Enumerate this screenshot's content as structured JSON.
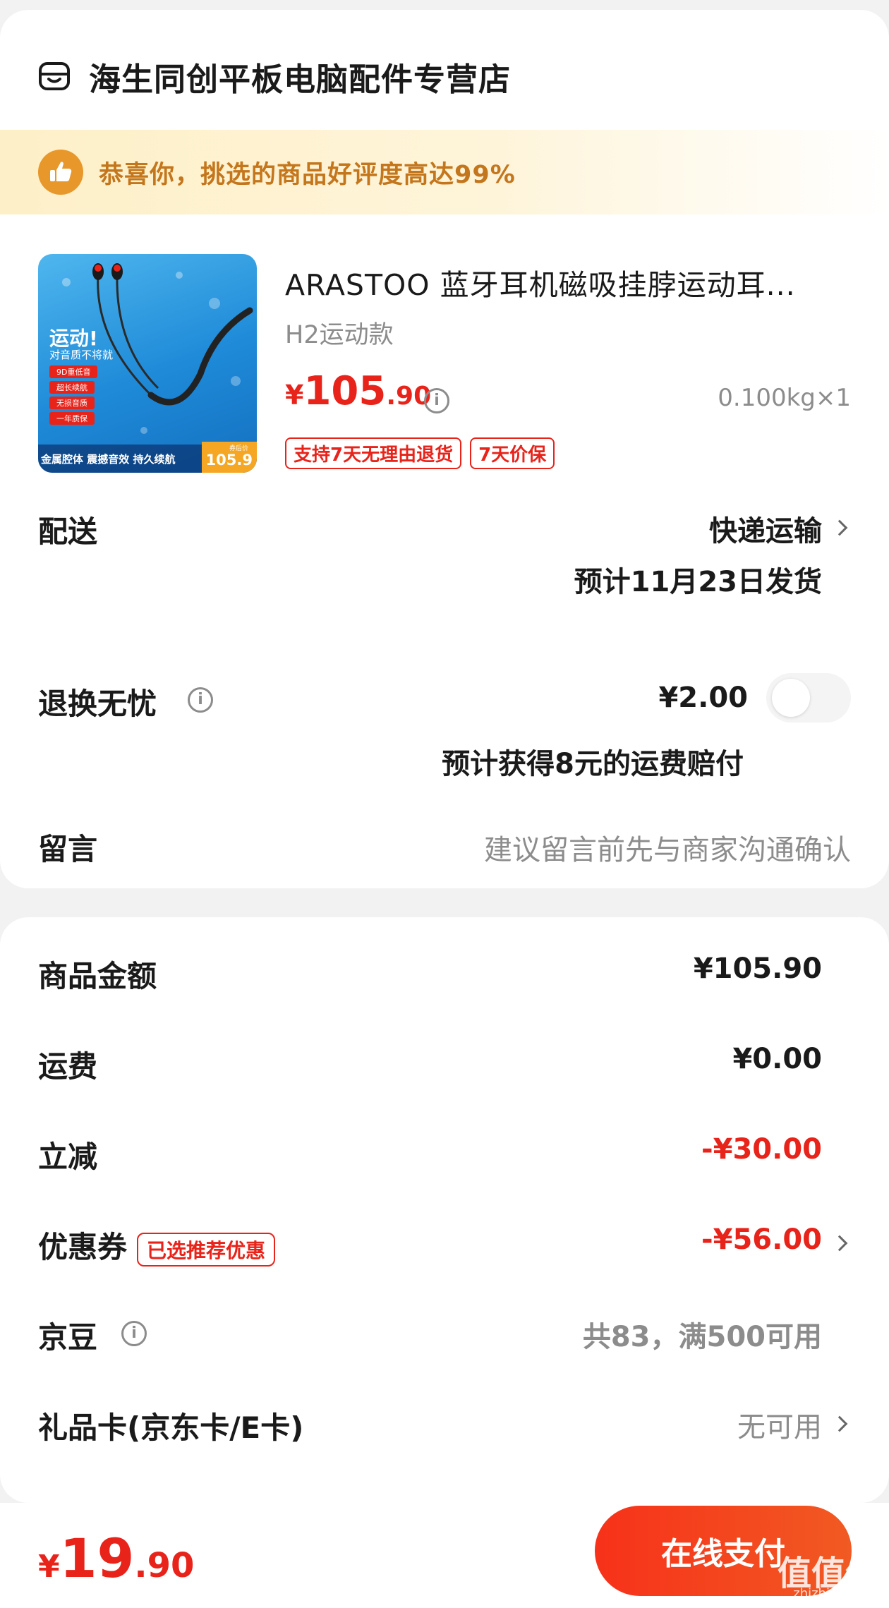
{
  "store": {
    "name": "海生同创平板电脑配件专营店",
    "banner": "恭喜你，挑选的商品好评度高达99%"
  },
  "product": {
    "title": "ARASTOO 蓝牙耳机磁吸挂脖运动耳...",
    "variant": "H2运动款",
    "price_symbol": "¥",
    "price_int": "105",
    "price_dec": ".90",
    "weight": "0.100kg×1",
    "tags": [
      "支持7天无理由退货",
      "7天价保"
    ],
    "image_text": {
      "headline": "运动!",
      "sub": "对音质不将就",
      "features": [
        "9D重低音",
        "超长续航",
        "无损音质",
        "一年质保"
      ],
      "bottom": "金属腔体 震撼音效 持久续航",
      "price_badge_label": "券后价",
      "price_badge": "105.9"
    }
  },
  "delivery": {
    "label": "配送",
    "method": "快递运输",
    "eta": "预计11月23日发货"
  },
  "return_service": {
    "label": "退换无忧",
    "price": "¥2.00",
    "note": "预计获得8元的运费赔付",
    "enabled": false
  },
  "message": {
    "label": "留言",
    "placeholder": "建议留言前先与商家沟通确认"
  },
  "summary": {
    "goods_label": "商品金额",
    "goods_value": "¥105.90",
    "shipping_label": "运费",
    "shipping_value": "¥0.00",
    "discount_label": "立减",
    "discount_value": "-¥30.00",
    "coupon_label": "优惠券",
    "coupon_badge": "已选推荐优惠",
    "coupon_value": "-¥56.00",
    "beans_label": "京豆",
    "beans_value": "共83，满500可用",
    "giftcard_label": "礼品卡(京东卡/E卡)",
    "giftcard_value": "无可用"
  },
  "footer": {
    "total_symbol": "¥",
    "total_int": "19",
    "total_dec": ".90",
    "pay_label": "在线支付",
    "watermark": "值值值",
    "watermark_sub": "zhizhizhi.com"
  },
  "colors": {
    "accent": "#e8231a",
    "banner_text": "#c4761c",
    "banner_icon": "#e8972a",
    "pay_button": "#f7311a"
  }
}
